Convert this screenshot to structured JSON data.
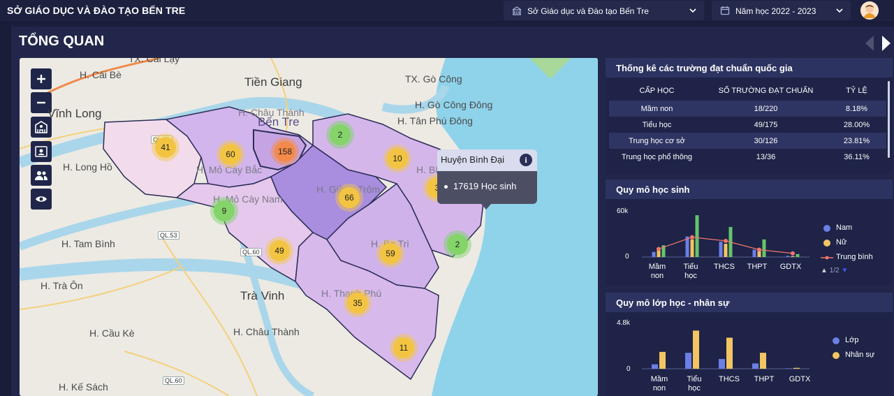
{
  "header": {
    "app_title": "SỞ GIÁO DỤC VÀ ĐÀO TẠO BẾN TRE",
    "unit_select": "Sở Giáo dục và Đào tạo Bến Tre",
    "year_select": "Năm học 2022 - 2023"
  },
  "page": {
    "title": "TỔNG QUAN"
  },
  "map": {
    "places": {
      "tx_cai_lay": "TX. Cai Lậy",
      "cai_be": "H. Cái Bè",
      "vinh_long": "Vĩnh Long",
      "long_ho": "H. Long Hồ",
      "tam_binh": "H. Tam Bình",
      "tra_on": "H. Trà Ôn",
      "cau_ke": "H. Cầu Kè",
      "ke_sach": "H. Kế Sách",
      "tien_giang": "Tiền Giang",
      "tx_go_cong": "TX. Gò Công",
      "go_cong_dong": "H. Gò Công Đông",
      "tan_phu_dong": "H. Tân Phú Đông",
      "tra_vinh": "Trà Vinh",
      "chau_thanh_tv": "H. Châu Thành",
      "chau_thanh_bt": "H. Châu Thành",
      "ben_tre": "Bến Tre",
      "mo_cay_bac": "H. Mỏ Cày Bắc",
      "mo_cay_nam": "H. Mỏ Cày Nam",
      "giong_trom": "H. Giồng Trôm",
      "binh_dai": "H. Bình Đại",
      "ba_tri": "H. Ba Tri",
      "thanh_phu": "H. Thạnh Phú"
    },
    "roads": {
      "ql53": "QL.53",
      "ql60a": "QL.60",
      "ql60b": "QL.60",
      "ql_top": "QL.60"
    },
    "clusters": [
      {
        "id": "c41",
        "count": "41",
        "color": "yellow"
      },
      {
        "id": "c60",
        "count": "60",
        "color": "yellow"
      },
      {
        "id": "c158",
        "count": "158",
        "color": "orange"
      },
      {
        "id": "c2a",
        "count": "2",
        "color": "green"
      },
      {
        "id": "c10",
        "count": "10",
        "color": "yellow"
      },
      {
        "id": "c3",
        "count": "3",
        "color": "yellow"
      },
      {
        "id": "c9",
        "count": "9",
        "color": "green"
      },
      {
        "id": "c66",
        "count": "66",
        "color": "yellow"
      },
      {
        "id": "c2b",
        "count": "2",
        "color": "green"
      },
      {
        "id": "c49",
        "count": "49",
        "color": "yellow"
      },
      {
        "id": "c59",
        "count": "59",
        "color": "yellow"
      },
      {
        "id": "c35",
        "count": "35",
        "color": "yellow"
      },
      {
        "id": "c11",
        "count": "11",
        "color": "yellow"
      }
    ],
    "tooltip": {
      "title": "Huyện Bình Đại",
      "value": "17619 Học sinh"
    },
    "controls": [
      "zoom-in",
      "zoom-out",
      "school-layer",
      "student-layer",
      "staff-layer",
      "visibility"
    ]
  },
  "standards_panel": {
    "title": "Thống kê các trường đạt chuẩn quốc gia",
    "columns": [
      "CẤP HỌC",
      "SỐ TRƯỜNG ĐẠT CHUẨN",
      "TỶ LỆ"
    ],
    "rows": [
      {
        "level": "Mầm non",
        "count": "18/220",
        "ratio": "8.18%"
      },
      {
        "level": "Tiểu học",
        "count": "49/175",
        "ratio": "28.00%"
      },
      {
        "level": "Trung học cơ sở",
        "count": "30/126",
        "ratio": "23.81%"
      },
      {
        "level": "Trung học phổ thông",
        "count": "13/36",
        "ratio": "36.11%"
      }
    ]
  },
  "students_panel": {
    "title": "Quy mô học sinh",
    "pager": "1/2"
  },
  "classes_panel": {
    "title": "Quy mô lớp học - nhân sự"
  },
  "chart_data": [
    {
      "type": "bar",
      "title": "Quy mô học sinh",
      "categories": [
        "Mầm non",
        "Tiểu học",
        "THCS",
        "THPT",
        "GDTX"
      ],
      "ytick_labels": [
        "60k",
        "0"
      ],
      "ylim": [
        0,
        60000
      ],
      "series": [
        {
          "name": "Nam",
          "values": [
            7000,
            28000,
            21000,
            10000,
            1500
          ]
        },
        {
          "name": "Nữ",
          "values": [
            9000,
            24000,
            18000,
            9000,
            1200
          ]
        },
        {
          "name": "Trung bình",
          "type": "line",
          "values": [
            11000,
            27000,
            22000,
            10000,
            5000
          ]
        },
        {
          "name": "",
          "values": [
            16000,
            57000,
            41000,
            24000,
            4000
          ]
        }
      ],
      "legend": "right",
      "colors": {
        "Nam": "#6b7fe6",
        "Nữ": "#f2c562",
        "Trung bình": "#f0776c",
        "other": "#67c46a"
      }
    },
    {
      "type": "bar",
      "title": "Quy mô lớp học - nhân sự",
      "categories": [
        "Mầm non",
        "Tiểu học",
        "THCS",
        "THPT",
        "GDTX"
      ],
      "ytick_labels": [
        "4.8k",
        "0"
      ],
      "ylim": [
        0,
        4800
      ],
      "series": [
        {
          "name": "Lớp",
          "values": [
            500,
            1800,
            1100,
            600,
            50
          ]
        },
        {
          "name": "Nhân sự",
          "values": [
            1900,
            4300,
            3500,
            1800,
            100
          ]
        }
      ],
      "legend": "right",
      "colors": {
        "Lớp": "#6b7fe6",
        "Nhân sự": "#f2c562"
      }
    }
  ]
}
